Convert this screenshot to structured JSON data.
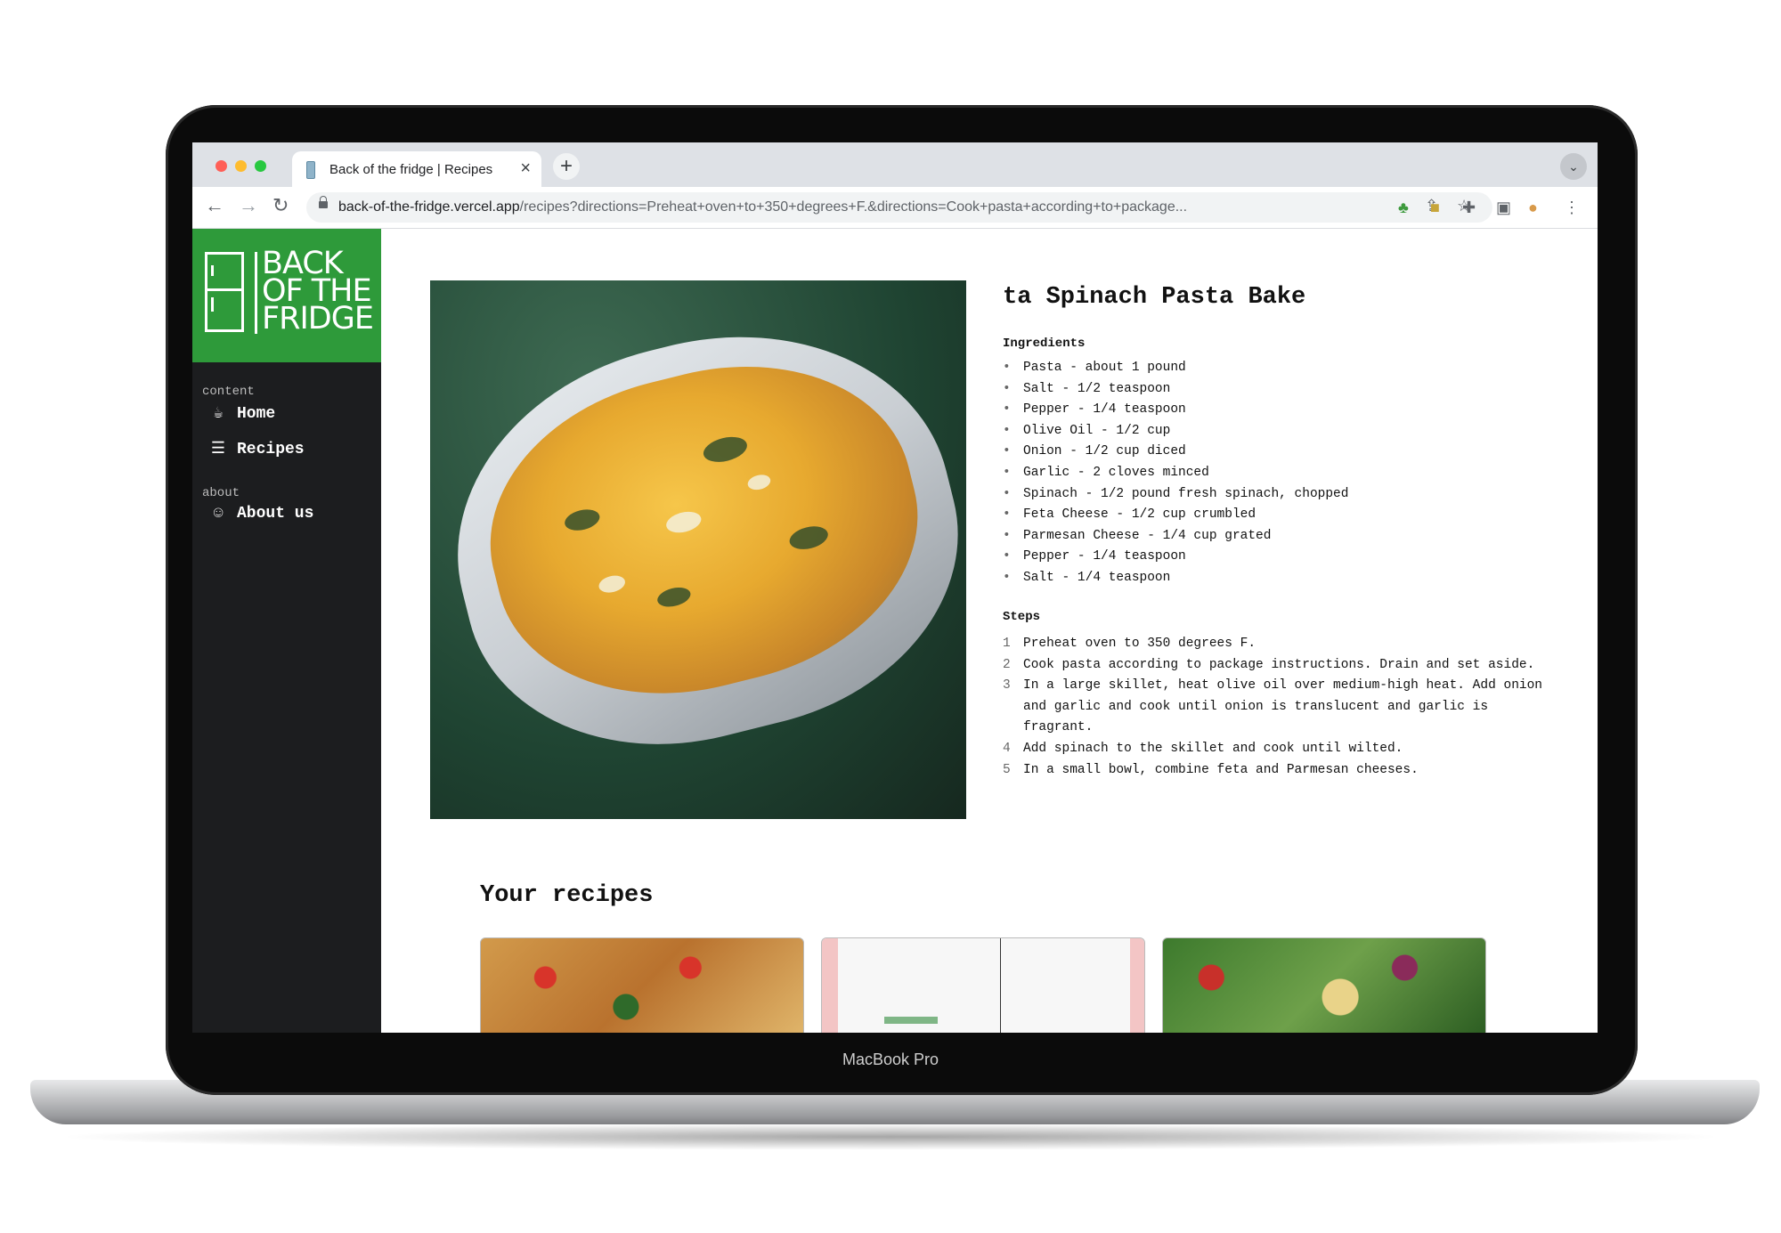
{
  "device_label": "MacBook Pro",
  "browser": {
    "tab_title": "Back of the fridge | Recipes",
    "url_host": "back-of-the-fridge.vercel.app",
    "url_path": "/recipes?directions=Preheat+oven+to+350+degrees+F.&directions=Cook+pasta+according+to+package..."
  },
  "sidebar": {
    "logo_lines": [
      "BACK",
      "OF THE",
      "FRIDGE"
    ],
    "sections": [
      {
        "label": "content",
        "items": [
          {
            "label": "Home",
            "icon": "coffee-icon"
          },
          {
            "label": "Recipes",
            "icon": "list-icon"
          }
        ]
      },
      {
        "label": "about",
        "items": [
          {
            "label": "About us",
            "icon": "users-icon"
          }
        ]
      }
    ]
  },
  "recipe": {
    "title": "ta Spinach Pasta Bake",
    "ingredients_heading": "Ingredients",
    "ingredients": [
      "Pasta - about 1 pound",
      "Salt - 1/2 teaspoon",
      "Pepper - 1/4 teaspoon",
      "Olive Oil - 1/2 cup",
      "Onion - 1/2 cup diced",
      "Garlic - 2 cloves minced",
      "Spinach - 1/2 pound fresh spinach, chopped",
      "Feta Cheese - 1/2 cup crumbled",
      "Parmesan Cheese - 1/4 cup grated",
      "Pepper - 1/4 teaspoon",
      "Salt - 1/4 teaspoon"
    ],
    "steps_heading": "Steps",
    "steps": [
      "Preheat oven to 350 degrees F.",
      "Cook pasta according to package instructions. Drain and set aside.",
      "In a large skillet, heat olive oil over medium-high heat. Add onion and garlic and cook until onion is translucent and garlic is fragrant.",
      "Add spinach to the skillet and cook until wilted.",
      "In a small bowl, combine feta and Parmesan cheeses."
    ]
  },
  "your_recipes": {
    "heading": "Your recipes"
  },
  "colors": {
    "brand_green": "#2e9a3a",
    "sidebar_bg": "#1c1d1f"
  }
}
